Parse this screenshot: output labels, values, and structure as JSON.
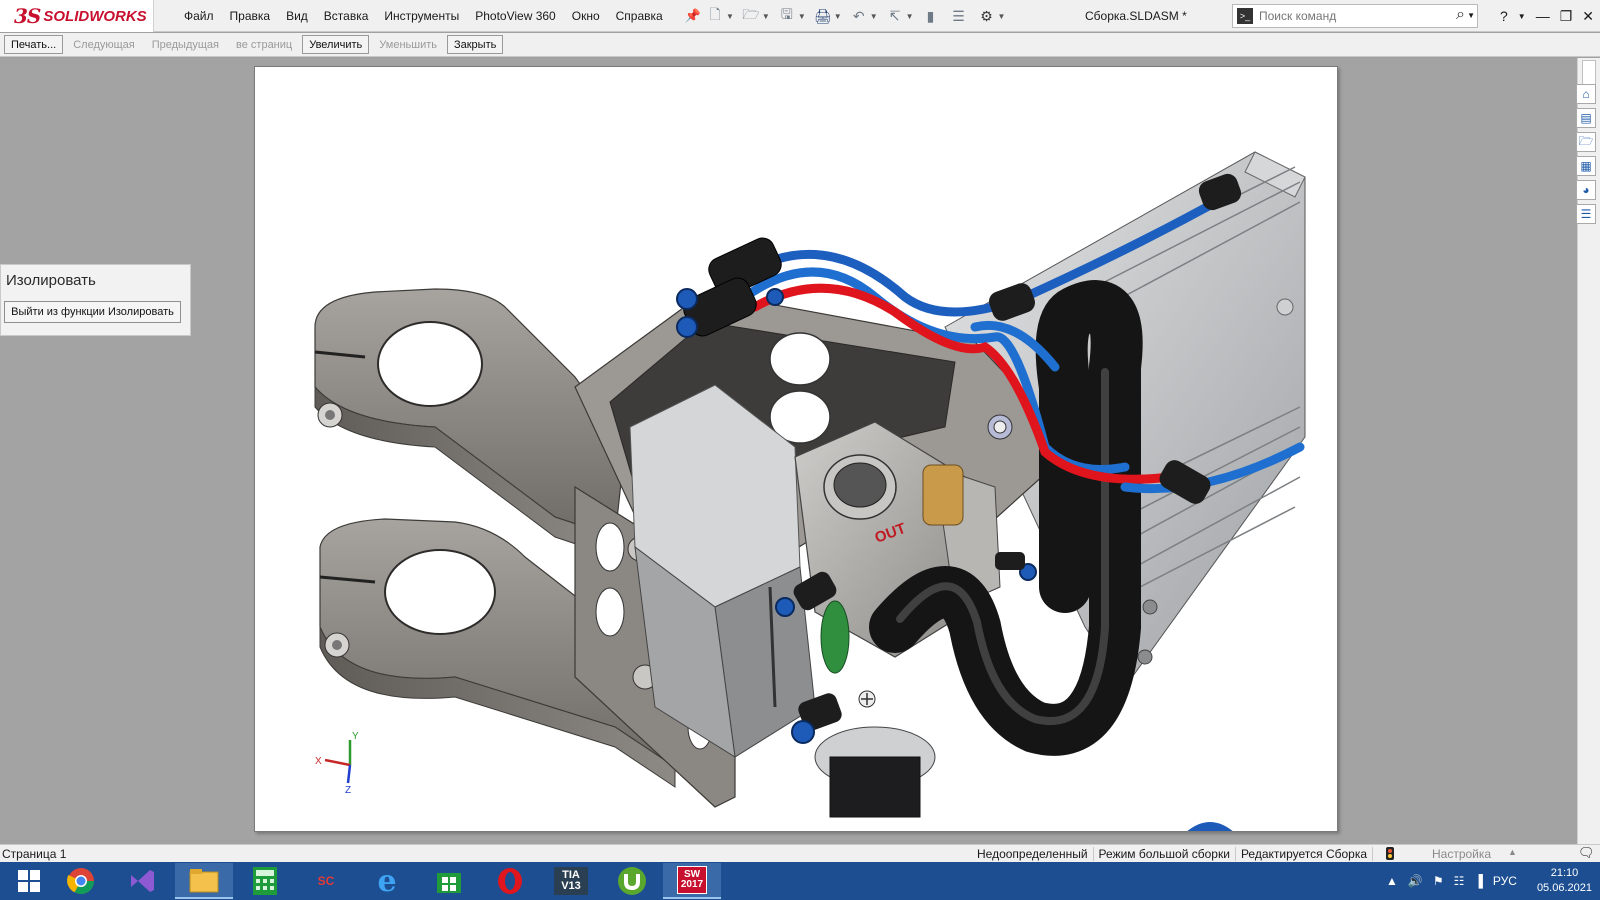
{
  "app": {
    "brand_ds": "3S",
    "brand_name": "SOLIDWORKS",
    "menu": [
      "Файл",
      "Правка",
      "Вид",
      "Вставка",
      "Инструменты",
      "PhotoView 360",
      "Окно",
      "Справка"
    ],
    "document_title": "Сборка.SLDASM *",
    "search_placeholder": "Поиск команд",
    "help_label": "?"
  },
  "print_toolbar": {
    "buttons": [
      {
        "label": "Печать...",
        "enabled": true
      },
      {
        "label": "Следующая",
        "enabled": false
      },
      {
        "label": "Предыдущая",
        "enabled": false
      },
      {
        "label": "ве страниц",
        "enabled": false
      },
      {
        "label": "Увеличить",
        "enabled": true
      },
      {
        "label": "Уменьшить",
        "enabled": false
      },
      {
        "label": "Закрыть",
        "enabled": true
      }
    ]
  },
  "isolate_panel": {
    "title": "Изолировать",
    "exit_button": "Выйти из функции Изолировать"
  },
  "model": {
    "label_out": "OUT",
    "triad": {
      "x": "X",
      "y": "Y",
      "z": "Z"
    },
    "colors": {
      "metal": "#8f8c87",
      "hose": "#1b1b1b",
      "tube_blue": "#1e6fd0",
      "tube_red": "#e0141c",
      "fitting": "#1d1d1d",
      "aluminum": "#c4c6c8",
      "brass": "#c89a4a",
      "gasket": "#2f8f3f"
    }
  },
  "status": {
    "page": "Страница 1",
    "fields": [
      "Недоопределенный",
      "Режим большой сборки",
      "Редактируется Сборка"
    ],
    "customize": "Настройка"
  },
  "taskbar": {
    "apps": [
      {
        "name": "windows-start",
        "label": ""
      },
      {
        "name": "chrome",
        "label": ""
      },
      {
        "name": "visual-studio",
        "label": ""
      },
      {
        "name": "file-explorer",
        "label": ""
      },
      {
        "name": "calculator",
        "label": ""
      },
      {
        "name": "sc-tool",
        "label": "SC"
      },
      {
        "name": "internet-explorer",
        "label": "e"
      },
      {
        "name": "store",
        "label": ""
      },
      {
        "name": "opera",
        "label": "O"
      },
      {
        "name": "tia-portal",
        "label": "TIA V13"
      },
      {
        "name": "utorrent",
        "label": "µ"
      },
      {
        "name": "solidworks-2017",
        "label": "SW 2017"
      }
    ],
    "lang": "РУС",
    "time": "21:10",
    "date": "05.06.2021"
  }
}
